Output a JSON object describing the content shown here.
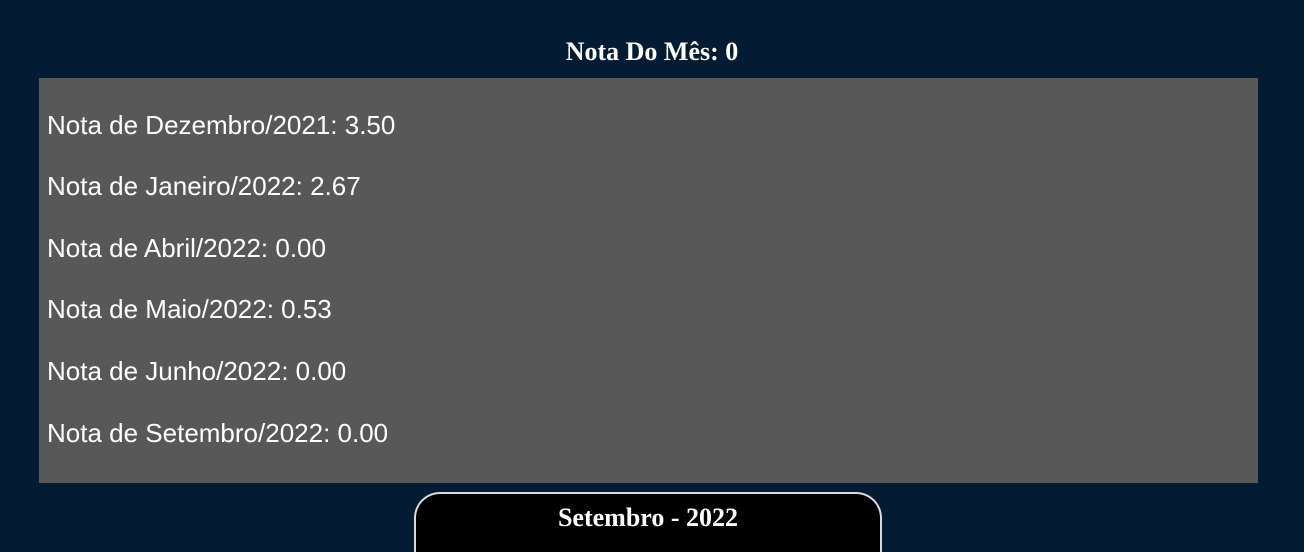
{
  "header": {
    "title": "Nota Do Mês: 0"
  },
  "notes": [
    {
      "label": "Nota de Dezembro/2021: 3.50"
    },
    {
      "label": "Nota de Janeiro/2022: 2.67"
    },
    {
      "label": "Nota de Abril/2022: 0.00"
    },
    {
      "label": "Nota de Maio/2022: 0.53"
    },
    {
      "label": "Nota de Junho/2022: 0.00"
    },
    {
      "label": "Nota de Setembro/2022: 0.00"
    }
  ],
  "month_selector": {
    "label": "Setembro - 2022"
  },
  "colors": {
    "background": "#031c33",
    "panel": "#585858",
    "text": "#ffffff",
    "tab_background": "#000000",
    "tab_border": "#d9d9d9"
  }
}
